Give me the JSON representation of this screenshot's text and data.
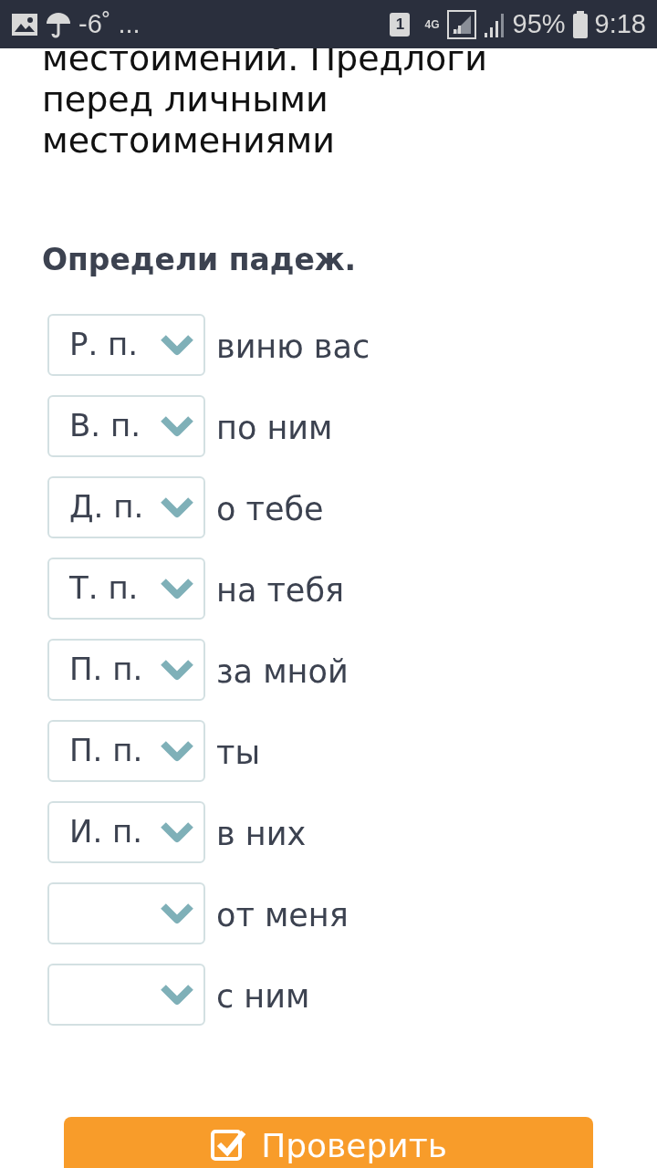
{
  "status_bar": {
    "temperature": "-6˚",
    "more": "...",
    "sim": "1",
    "network": "4G",
    "battery": "95%",
    "time": "9:18"
  },
  "title": [
    "местоимений. Предлоги",
    "перед личными",
    "местоимениями"
  ],
  "task": "Определи падеж.",
  "rows": [
    {
      "value": "Р. п.",
      "phrase": "виню вас"
    },
    {
      "value": "В. п.",
      "phrase": "по ним"
    },
    {
      "value": "Д. п.",
      "phrase": "о тебе"
    },
    {
      "value": "Т. п.",
      "phrase": "на тебя"
    },
    {
      "value": "П. п.",
      "phrase": "за мной"
    },
    {
      "value": "П. п.",
      "phrase": "ты"
    },
    {
      "value": "И. п.",
      "phrase": "в них"
    },
    {
      "phrase": "от меня"
    },
    {
      "phrase": "с ним"
    }
  ],
  "check_button": "Проверить"
}
